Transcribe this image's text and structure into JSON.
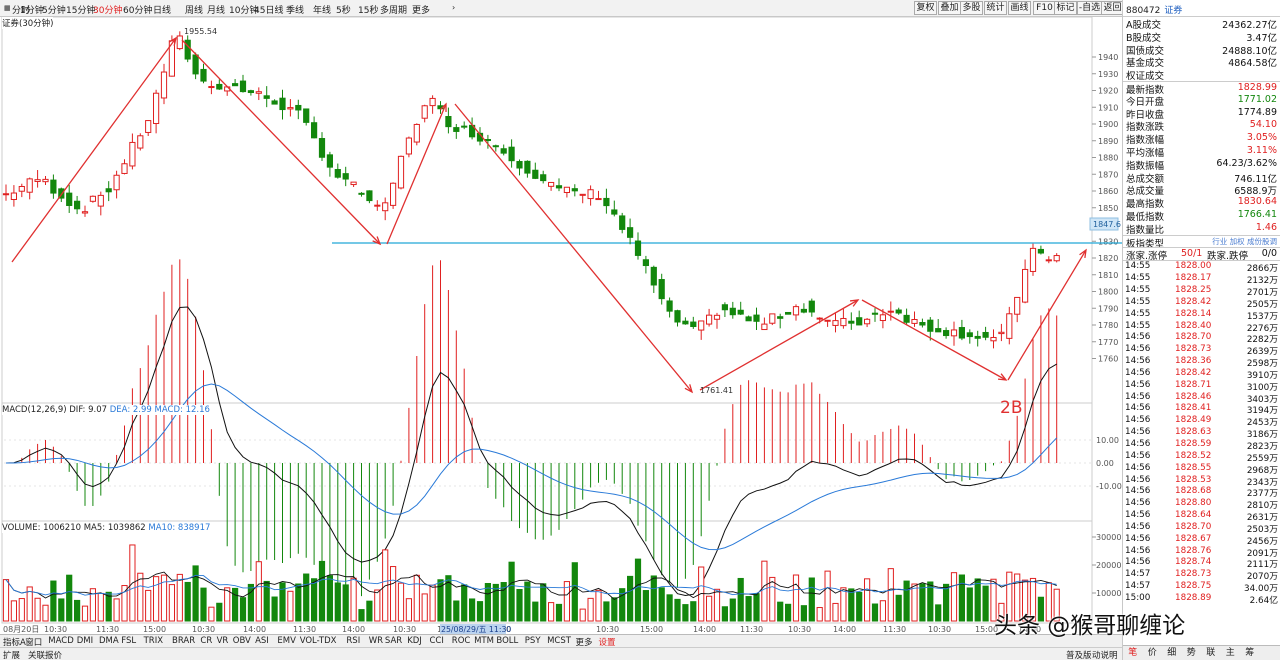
{
  "toolbar": {
    "timeframes": [
      "分时",
      "1分钟",
      "5分钟",
      "15分钟",
      "30分钟",
      "60分钟",
      "日线",
      "周线",
      "月线",
      "10分钟",
      "45日线",
      "季线",
      "年线",
      "5秒",
      "15秒",
      "多周期",
      "更多"
    ],
    "active": "30分钟",
    "right_buttons": [
      "复权",
      "叠加",
      "多股",
      "统计",
      "画线",
      "F10",
      "标记",
      "-自选",
      "返回"
    ]
  },
  "main_panel": {
    "title": "证券(30分钟)",
    "y_ticks": [
      "1940",
      "1930",
      "1920",
      "1910",
      "1900",
      "1890",
      "1880",
      "1870",
      "1860",
      "1850",
      "1840",
      "1830",
      "1820",
      "1810",
      "1800",
      "1790",
      "1780",
      "1770",
      "1760"
    ],
    "price_marker": "1847.6",
    "high_label": "1955.54",
    "low_label": "1761.41",
    "annotation": "2B"
  },
  "macd_panel": {
    "title": "MACD(12,26,9)",
    "dif_label": "DIF: 9.07",
    "dea_label": "DEA: 2.99",
    "macd_label": "MACD: 12.16",
    "y_ticks": [
      "10.00",
      "0.00",
      "-10.00"
    ]
  },
  "volume_panel": {
    "title": "VOLUME: 1006210",
    "ma5_label": "MA5: 1039862",
    "ma10_label": "MA10: 838917",
    "y_ticks": [
      "30000",
      "20000",
      "10000"
    ]
  },
  "x_axis": {
    "labels": [
      "08月20日",
      "10:30",
      "11:30",
      "15:00",
      "10:30",
      "14:00",
      "11:30",
      "14:00",
      "10:30",
      "15:00",
      "14:00",
      "25/08/29/五 11:30",
      "10:30",
      "15:00",
      "14:00",
      "11:30",
      "10:30",
      "14:00",
      "11:30",
      "10:30",
      "15:00",
      "14:00"
    ]
  },
  "indicator_tabs": [
    "指标A",
    "窗口",
    "MACD",
    "DMI",
    "DMA",
    "FSL",
    "TRIX",
    "BRAR",
    "CR",
    "VR",
    "OBV",
    "ASI",
    "EMV",
    "VOL-TDX",
    "RSI",
    "WR",
    "SAR",
    "KDJ",
    "CCI",
    "ROC",
    "MTM",
    "BOLL",
    "PSY",
    "MCST",
    "更多",
    "设置"
  ],
  "status": {
    "left": [
      "扩展",
      "关联报价"
    ],
    "right": [
      "普及版",
      "指标B",
      "动说明"
    ]
  },
  "quote": {
    "code": "880472",
    "name": "证券",
    "rows": [
      {
        "label": "A股成交",
        "value": "24362.27亿",
        "color": "bk"
      },
      {
        "label": "B股成交",
        "value": "3.47亿",
        "color": "bk"
      },
      {
        "label": "国债成交",
        "value": "24888.10亿",
        "color": "bk"
      },
      {
        "label": "基金成交",
        "value": "4864.58亿",
        "color": "bk"
      },
      {
        "label": "权证成交",
        "value": "",
        "color": "bk"
      },
      {
        "label": "最新指数",
        "value": "1828.99",
        "color": "up"
      },
      {
        "label": "今日开盘",
        "value": "1771.02",
        "color": "dn"
      },
      {
        "label": "昨日收盘",
        "value": "1774.89",
        "color": "bk"
      },
      {
        "label": "指数涨跌",
        "value": "54.10",
        "color": "up"
      },
      {
        "label": "指数涨幅",
        "value": "3.05%",
        "color": "up"
      },
      {
        "label": "平均涨幅",
        "value": "3.11%",
        "color": "up"
      },
      {
        "label": "指数振幅",
        "value": "64.23/3.62%",
        "color": "bk"
      },
      {
        "label": "总成交额",
        "value": "746.11亿",
        "color": "bk"
      },
      {
        "label": "总成交量",
        "value": "6588.9万",
        "color": "bk"
      },
      {
        "label": "最高指数",
        "value": "1830.64",
        "color": "up"
      },
      {
        "label": "最低指数",
        "value": "1766.41",
        "color": "dn"
      },
      {
        "label": "指数量比",
        "value": "1.46",
        "color": "up"
      },
      {
        "label": "板指类型",
        "value": "行业 加权 成份股调",
        "color": "bk"
      }
    ],
    "breadth": {
      "label1": "涨家.涨停",
      "value1": "50/1",
      "label2": "跌家.跌停",
      "value2": "0/0"
    },
    "ticks": [
      [
        "14:55",
        "1828.00",
        "2866万"
      ],
      [
        "14:55",
        "1828.17",
        "2132万"
      ],
      [
        "14:55",
        "1828.25",
        "2701万"
      ],
      [
        "14:55",
        "1828.42",
        "2505万"
      ],
      [
        "14:55",
        "1828.14",
        "1537万"
      ],
      [
        "14:55",
        "1828.40",
        "2276万"
      ],
      [
        "14:56",
        "1828.70",
        "2282万"
      ],
      [
        "14:56",
        "1828.73",
        "2639万"
      ],
      [
        "14:56",
        "1828.36",
        "2598万"
      ],
      [
        "14:56",
        "1828.42",
        "3910万"
      ],
      [
        "14:56",
        "1828.71",
        "3100万"
      ],
      [
        "14:56",
        "1828.46",
        "3403万"
      ],
      [
        "14:56",
        "1828.41",
        "3194万"
      ],
      [
        "14:56",
        "1828.49",
        "2453万"
      ],
      [
        "14:56",
        "1828.63",
        "3186万"
      ],
      [
        "14:56",
        "1828.59",
        "2823万"
      ],
      [
        "14:56",
        "1828.52",
        "2559万"
      ],
      [
        "14:56",
        "1828.55",
        "2968万"
      ],
      [
        "14:56",
        "1828.53",
        "2343万"
      ],
      [
        "14:56",
        "1828.68",
        "2377万"
      ],
      [
        "14:56",
        "1828.80",
        "2810万"
      ],
      [
        "14:56",
        "1828.64",
        "2631万"
      ],
      [
        "14:56",
        "1828.70",
        "2503万"
      ],
      [
        "14:56",
        "1828.67",
        "2456万"
      ],
      [
        "14:56",
        "1828.76",
        "2091万"
      ],
      [
        "14:56",
        "1828.74",
        "2111万"
      ],
      [
        "14:57",
        "1828.73",
        "2070万"
      ],
      [
        "14:57",
        "1828.75",
        "34.00万"
      ],
      [
        "15:00",
        "1828.89",
        "2.64亿"
      ]
    ],
    "bottom_tabs": [
      "笔",
      "价",
      "细",
      "势",
      "联",
      "主",
      "筹"
    ]
  },
  "watermark": "头条 @猴哥聊缠论",
  "colors": {
    "up": "#e02020",
    "down": "#13870d",
    "dif": "#111111",
    "dea": "#2a7ad8",
    "support": "#21a8d8",
    "trend": "#e03030"
  }
}
